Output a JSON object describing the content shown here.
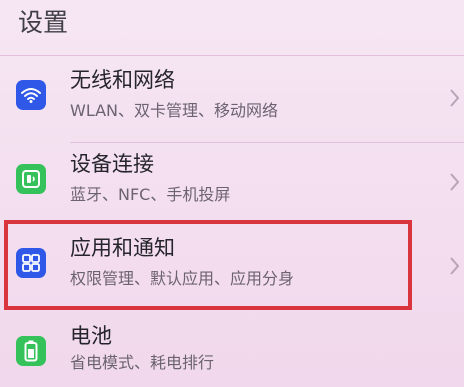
{
  "header": {
    "title": "设置"
  },
  "items": [
    {
      "title": "无线和网络",
      "subtitle": "WLAN、双卡管理、移动网络",
      "icon": "wifi-icon",
      "icon_color": "#2f58e8"
    },
    {
      "title": "设备连接",
      "subtitle": "蓝牙、NFC、手机投屏",
      "icon": "device-connection-icon",
      "icon_color": "#36c25a"
    },
    {
      "title": "应用和通知",
      "subtitle": "权限管理、默认应用、应用分身",
      "icon": "apps-grid-icon",
      "icon_color": "#2f58e8",
      "highlighted": true
    },
    {
      "title": "电池",
      "subtitle": "省电模式、耗电排行",
      "icon": "battery-icon",
      "icon_color": "#36c25a"
    }
  ],
  "colors": {
    "background": "#f2dcee",
    "highlight_border": "#d9353f"
  }
}
